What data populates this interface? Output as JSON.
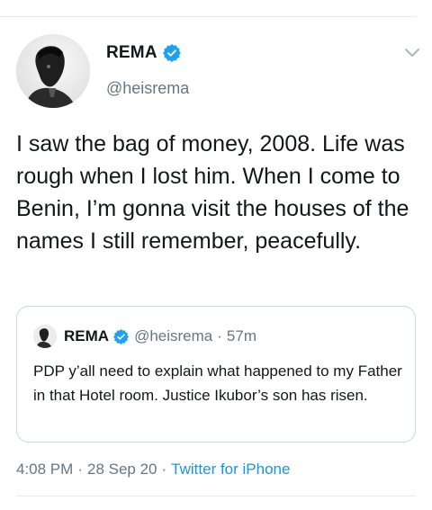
{
  "tweet": {
    "author": {
      "name": "REMA",
      "handle": "@heisrema",
      "verified": true
    },
    "text": "I saw the bag of money, 2008. Life was rough when I lost him. When I come to Benin, I’m gonna visit the houses of the names I still remember, peacefully.",
    "meta": {
      "time": "4:08 PM",
      "separator": "·",
      "date": "28 Sep 20",
      "source": "Twitter for iPhone"
    }
  },
  "quoted_tweet": {
    "author": {
      "name": "REMA",
      "handle": "@heisrema",
      "verified": true
    },
    "separator": "·",
    "age": "57m",
    "text": "PDP y’all need to explain what happened to my Father in that Hotel room. Justice Ikubor’s son has risen."
  },
  "icons": {
    "verified": "verified-badge-icon",
    "menu": "chevron-down-icon"
  },
  "colors": {
    "verified_blue": "#1da1f2",
    "secondary_text": "#657786",
    "link": "#1b95e0",
    "primary_text": "#14171a",
    "divider": "#e6ecf0"
  }
}
